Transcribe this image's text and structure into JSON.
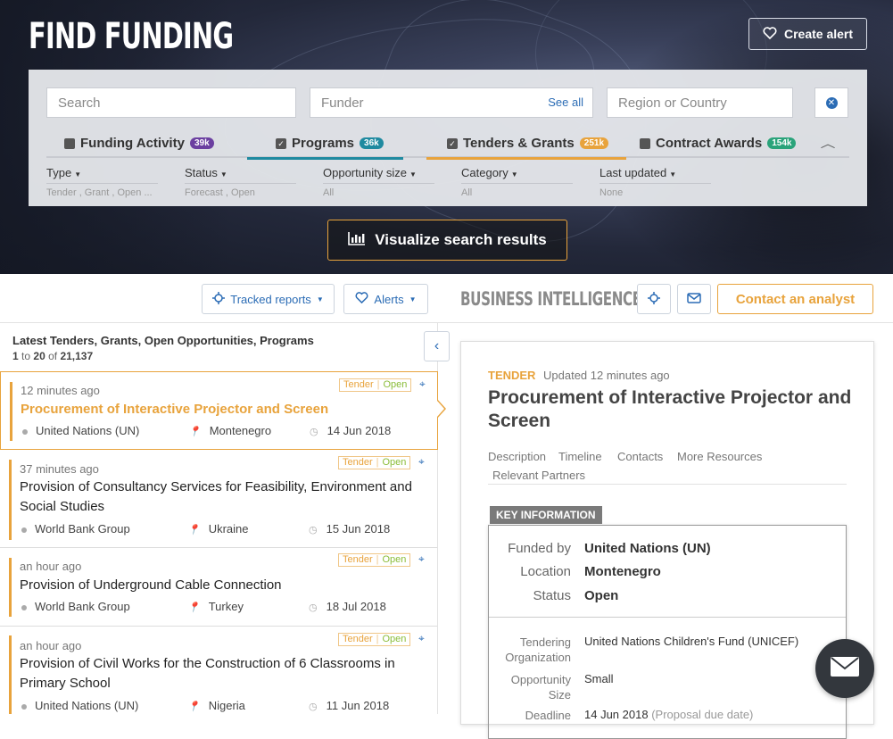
{
  "header": {
    "title": "FIND FUNDING",
    "create_alert": "Create alert"
  },
  "search": {
    "search_placeholder": "Search",
    "funder_placeholder": "Funder",
    "see_all": "See all",
    "region_placeholder": "Region or Country"
  },
  "tabs": [
    {
      "label": "Funding Activity",
      "count": "39k",
      "checked": false,
      "color": "#6b3fa0"
    },
    {
      "label": "Programs",
      "count": "36k",
      "checked": true,
      "color": "#1f8aa0"
    },
    {
      "label": "Tenders & Grants",
      "count": "251k",
      "checked": true,
      "color": "#e8a33c"
    },
    {
      "label": "Contract Awards",
      "count": "154k",
      "checked": false,
      "color": "#2aa37a"
    }
  ],
  "filters": [
    {
      "label": "Type",
      "value": "Tender , Grant , Open ..."
    },
    {
      "label": "Status",
      "value": "Forecast , Open"
    },
    {
      "label": "Opportunity size",
      "value": "All"
    },
    {
      "label": "Category",
      "value": "All"
    },
    {
      "label": "Last updated",
      "value": "None"
    }
  ],
  "visualize": "Visualize search results",
  "toolbar": {
    "tracked_reports": "Tracked reports",
    "alerts": "Alerts",
    "business_intelligence": "BUSINESS INTELLIGENCE",
    "contact": "Contact an analyst"
  },
  "list": {
    "heading": "Latest Tenders, Grants, Open Opportunities, Programs",
    "from": "1",
    "to_word": "to",
    "to": "20",
    "of_word": "of",
    "total": "21,137",
    "items": [
      {
        "time": "12 minutes ago",
        "type": "Tender",
        "status": "Open",
        "title": "Procurement of Interactive Projector and Screen",
        "funder": "United Nations (UN)",
        "country": "Montenegro",
        "date": "14 Jun 2018"
      },
      {
        "time": "37 minutes ago",
        "type": "Tender",
        "status": "Open",
        "title": "Provision of Consultancy Services for Feasibility, Environment and Social Studies",
        "funder": "World Bank Group",
        "country": "Ukraine",
        "date": "15 Jun 2018"
      },
      {
        "time": "an hour ago",
        "type": "Tender",
        "status": "Open",
        "title": "Provision of Underground Cable Connection",
        "funder": "World Bank Group",
        "country": "Turkey",
        "date": "18 Jul 2018"
      },
      {
        "time": "an hour ago",
        "type": "Tender",
        "status": "Open",
        "title": "Provision of Civil Works for the Construction of 6 Classrooms in Primary School",
        "funder": "United Nations (UN)",
        "country": "Nigeria",
        "date": "11 Jun 2018"
      }
    ]
  },
  "detail": {
    "type": "TENDER",
    "updated": "Updated 12 minutes ago",
    "title": "Procurement of Interactive Projector and Screen",
    "nav": [
      "Description",
      "Timeline",
      "Contacts",
      "More Resources",
      "Relevant Partners"
    ],
    "key_info_label": "KEY INFORMATION",
    "key_rows": [
      {
        "k": "Funded by",
        "v": "United Nations (UN)"
      },
      {
        "k": "Location",
        "v": "Montenegro"
      },
      {
        "k": "Status",
        "v": "Open"
      }
    ],
    "tendering_org_label_1": "Tendering",
    "tendering_org_label_2": "Organization",
    "tendering_org_value": "United Nations Children's Fund (UNICEF)",
    "opp_size_label_1": "Opportunity",
    "opp_size_label_2": "Size",
    "opp_size_value": "Small",
    "deadline_label": "Deadline",
    "deadline_value": "14 Jun 2018",
    "deadline_note": "(Proposal due date)"
  }
}
